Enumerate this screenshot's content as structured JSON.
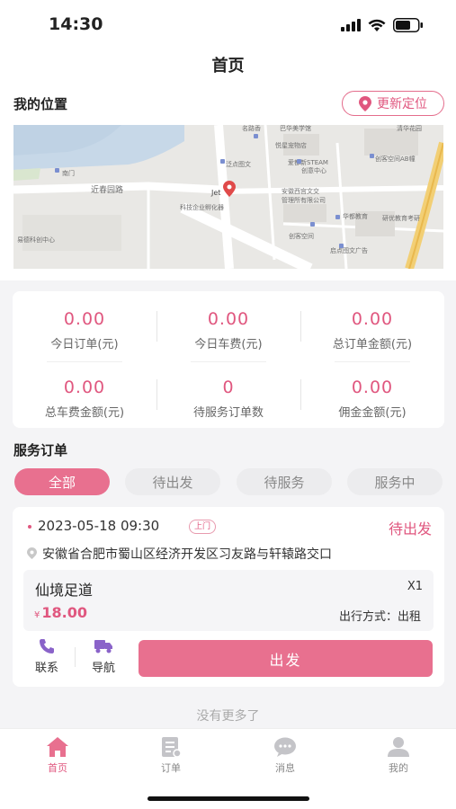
{
  "status_bar": {
    "time": "14:30"
  },
  "nav": {
    "title": "首页"
  },
  "location": {
    "title": "我的位置",
    "relocate_label": "更新定位",
    "map_labels": [
      "名路香",
      "巴华美学馆",
      "悦星宠物店",
      "泛点图文",
      "爱都新STEAM",
      "创意中心",
      "创客空间AB幢",
      "清华花园",
      "南门",
      "近春园路",
      "Jet",
      "科技企业孵化器",
      "安徽西宫文交",
      "管理所有限公司",
      "华都教育",
      "研优教育考研",
      "创客空间",
      "易德科创中心",
      "启点图文广告"
    ]
  },
  "stats": [
    {
      "value": "0.00",
      "label": "今日订单(元)"
    },
    {
      "value": "0.00",
      "label": "今日车费(元)"
    },
    {
      "value": "0.00",
      "label": "总订单金额(元)"
    },
    {
      "value": "0.00",
      "label": "总车费金额(元)"
    },
    {
      "value": "0",
      "label": "待服务订单数"
    },
    {
      "value": "0.00",
      "label": "佣金金额(元)"
    }
  ],
  "orders": {
    "title": "服务订单",
    "tabs": [
      "全部",
      "待出发",
      "待服务",
      "服务中"
    ],
    "active_tab": "全部",
    "order": {
      "datetime": "2023-05-18 09:30",
      "badge": "上门",
      "status": "待出发",
      "address": "安徽省合肥市蜀山区经济开发区习友路与轩辕路交口",
      "service_name": "仙境足道",
      "quantity": "X1",
      "currency": "¥",
      "price": "18.00",
      "travel_mode": "出行方式：出租",
      "contact_label": "联系",
      "navigate_label": "导航",
      "depart_label": "出发"
    },
    "no_more": "没有更多了"
  },
  "tab_bar": [
    {
      "label": "首页",
      "icon": "home-icon"
    },
    {
      "label": "订单",
      "icon": "order-icon"
    },
    {
      "label": "消息",
      "icon": "message-icon"
    },
    {
      "label": "我的",
      "icon": "profile-icon"
    }
  ],
  "colors": {
    "accent": "#e8708f",
    "accent_text": "#e0577f",
    "background": "#f4f4f6"
  }
}
